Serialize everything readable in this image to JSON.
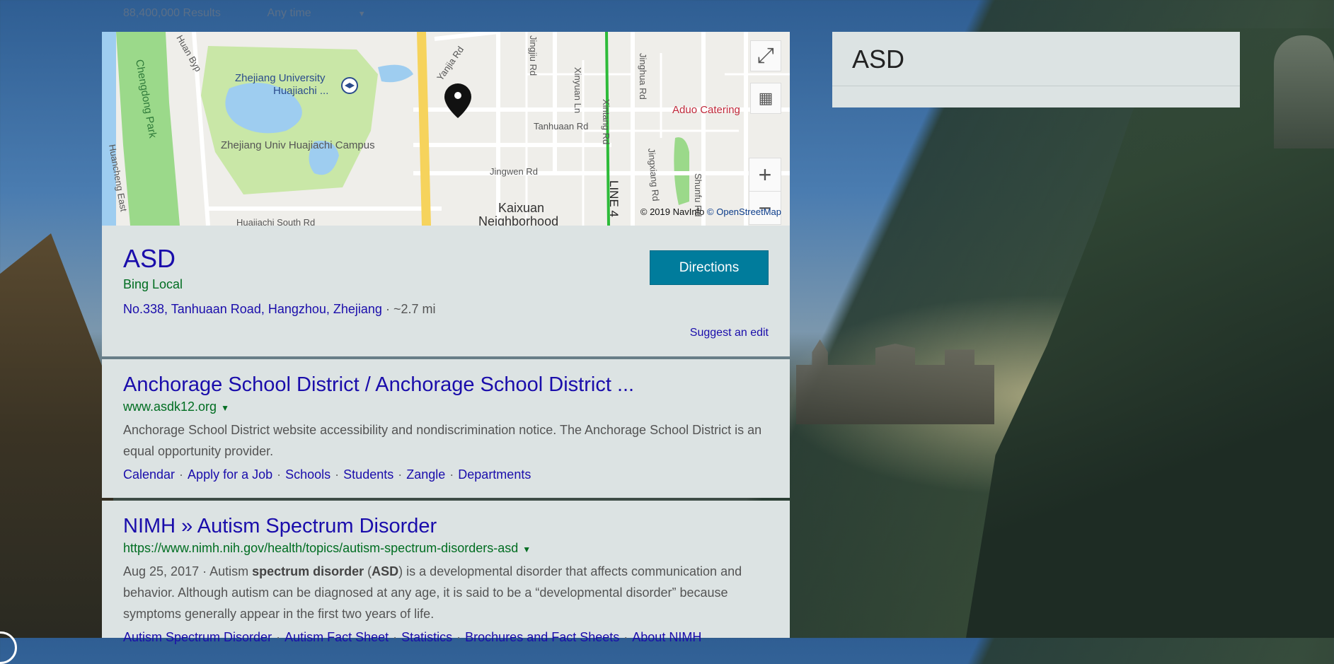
{
  "topbar": {
    "results": "88,400,000 Results",
    "time_filter": "Any time"
  },
  "map": {
    "labels": {
      "park": "Chengdong Park",
      "campus_name_1": "Zhejiang University",
      "campus_name_2": "Huajiachi ...",
      "campus": "Zhejiang Univ Huajiachi Campus",
      "yanjia": "Yanjia Rd",
      "jingjiu": "Jingjiu Rd",
      "xinyuan": "Xinyuan Ln",
      "jinghua": "Jinghua Rd",
      "xintang": "Xintang Rd",
      "tanhuaan": "Tanhuaan Rd",
      "jingwen": "Jingwen Rd",
      "jingxiang": "Jingxiang Rd",
      "shunfu": "Shunfu Rd",
      "huancheng": "Huancheng East",
      "kaixuan1": "Kaixuan",
      "kaixuan2": "Neighborhood",
      "line4": "LINE 4",
      "aduo": "Aduo Catering",
      "byp": "Huan Byp",
      "south": "Huajiachi South Rd"
    },
    "attribution_prefix": "© 2019 NavInfo",
    "attribution_link": "© OpenStreetMap",
    "icons": [
      "expand-icon",
      "traffic-icon",
      "zoom-in-icon",
      "zoom-out-icon",
      "location-pin-icon"
    ]
  },
  "local": {
    "title": "ASD",
    "source": "Bing Local",
    "address": "No.338, Tanhuaan Road, Hangzhou, Zhejiang",
    "distance": " · ~2.7 mi",
    "directions_label": "Directions",
    "suggest_edit": "Suggest an edit"
  },
  "results": [
    {
      "title": "Anchorage School District / Anchorage School District ...",
      "url": "www.asdk12.org",
      "snippet": "Anchorage School District website accessibility and nondiscrimination notice. The Anchorage School District is an equal opportunity provider.",
      "links": [
        "Calendar",
        "Apply for a Job",
        "Schools",
        "Students",
        "Zangle",
        "Departments"
      ]
    },
    {
      "title": "NIMH » Autism Spectrum Disorder",
      "url": "https://www.nimh.nih.gov/health/topics/autism-spectrum-disorders-asd",
      "snippet_date": "Aug 25, 2017 · Autism ",
      "snippet_b1": "spectrum disorder",
      "snippet_mid": " (",
      "snippet_b2": "ASD",
      "snippet_rest": ") is a developmental disorder that affects communication and behavior. Although autism can be diagnosed at any age, it is said to be a “developmental disorder” because symptoms generally appear in the first two years of life.",
      "links": [
        "Autism Spectrum Disorder",
        "Autism Fact Sheet",
        "Statistics",
        "Brochures and Fact Sheets",
        "About NIMH"
      ]
    }
  ],
  "sidebar": {
    "title": "ASD"
  },
  "colors": {
    "link": "#1a0dab",
    "url": "#006d21",
    "button": "#007c9c",
    "card": "#dce3e3"
  }
}
